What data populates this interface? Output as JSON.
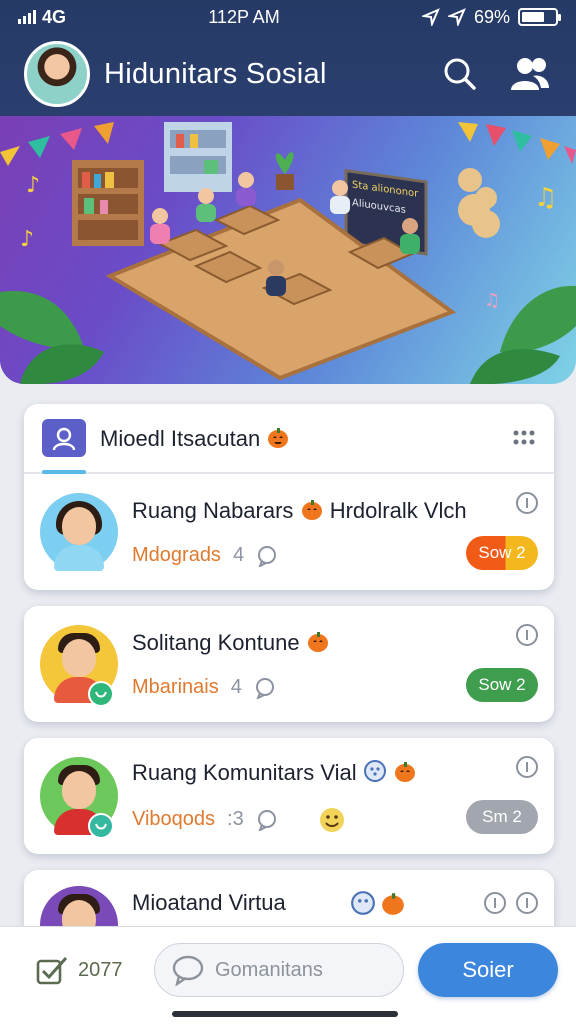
{
  "status_bar": {
    "network": "4G",
    "time": "112P AM",
    "battery": "69%"
  },
  "header": {
    "title": "Hidunitars Sosial"
  },
  "banner": {
    "sign_line1": "Sta aliononor",
    "sign_line2": "Aliuouvcas"
  },
  "section": {
    "title": "Mioedl Itsacutan"
  },
  "rooms": [
    {
      "name": "Ruang Nabarars",
      "name_suffix": "Hrdolralk Vlch",
      "tag": "Mdograds",
      "count": "4",
      "pill": "Sow 2",
      "pill_color": "#f06a1e"
    },
    {
      "name": "Solitang Kontune",
      "tag": "Mbarinais",
      "count": "4",
      "pill": "Sow 2",
      "pill_color": "#3f9e4d"
    },
    {
      "name": "Ruang Komunitars Vial",
      "tag": "Viboqods",
      "count": ":3",
      "pill": "Sm 2",
      "pill_color": "#a2a6ae"
    },
    {
      "name": "Mioatand Virtua"
    }
  ],
  "bottom_bar": {
    "count": "2077",
    "input_placeholder": "Gomanitans",
    "send_label": "Soier"
  },
  "colors": {
    "header_bg": "#263a66",
    "accent": "#3d86de",
    "orange_text": "#e07a2e"
  },
  "icons": [
    "search-icon",
    "people-icon",
    "user-icon",
    "grid-dots-icon",
    "info-icon",
    "chat-bubble-icon",
    "check-icon",
    "pumpkin-icon"
  ]
}
